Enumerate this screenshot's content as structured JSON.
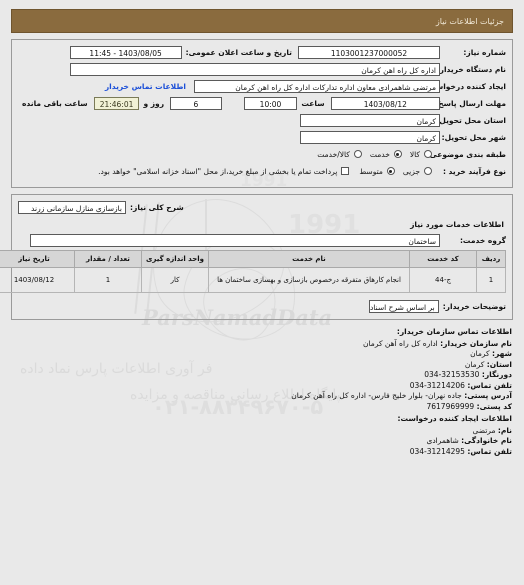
{
  "header": {
    "title": "جزئیات اطلاعات نیاز"
  },
  "form": {
    "need_number_label": "شماره نیاز:",
    "need_number_value": "1103001237000052",
    "announce_datetime_label": "تاریخ و ساعت اعلان عمومی:",
    "announce_datetime_value": "1403/08/05 - 11:45",
    "buyer_org_label": "نام دستگاه خریدار:",
    "buyer_org_value": "اداره کل راه اهن کرمان",
    "requester_label": "ایجاد کننده درخواست:",
    "requester_value": "مرتضی  شاهمرادی  معاون اداره تدارکات  اداره کل راه اهن کرمان",
    "buyer_contact_link": "اطلاعات تماس خریدار",
    "deadline_label": "مهلت ارسال پاسخ: تا تاریخ:",
    "deadline_date": "1403/08/12",
    "deadline_hour_label": "ساعت",
    "deadline_hour": "10:00",
    "remaining_days": "6",
    "days_and_label": "روز و",
    "remaining_time": "21:46:01",
    "remaining_suffix": "ساعت باقی مانده",
    "province_label": "استان محل تحویل:",
    "province_value": "کرمان",
    "city_label": "شهر محل تحویل:",
    "city_value": "کرمان",
    "category_label": "طبقه بندی موضوعی:",
    "category_options": [
      {
        "label": "کالا",
        "selected": false
      },
      {
        "label": "خدمت",
        "selected": true
      },
      {
        "label": "کالا/خدمت",
        "selected": false
      }
    ],
    "process_label": "نوع فرآیند خرید :",
    "process_options": [
      {
        "label": "جزیی",
        "selected": false
      },
      {
        "label": "متوسط",
        "selected": true
      }
    ],
    "payment_checkbox_label": "پرداخت تمام یا بخشی از مبلغ خرید،از محل \"اسناد خزانه اسلامی\" خواهد بود.",
    "payment_checked": false
  },
  "need": {
    "summary_label": "شرح کلی نیاز:",
    "summary_value": "بازسازی منازل سازمانی زرند",
    "services_section_title": "اطلاعات خدمات مورد نیاز",
    "service_group_label": "گروه خدمت:",
    "service_group_value": "ساختمان"
  },
  "table": {
    "columns": [
      "ردیف",
      "کد خدمت",
      "نام خدمت",
      "واحد اندازه گیری",
      "تعداد / مقدار",
      "تاریخ نیاز"
    ],
    "rows": [
      {
        "row_no": "1",
        "service_code": "ج-44",
        "service_name": "انجام کارهاق متفرقه درخصوص بازسازی و بهسازی ساختمان ها",
        "unit": "کار",
        "quantity": "1",
        "need_date": "1403/08/12"
      }
    ]
  },
  "buyer_note": {
    "label": "توضیحات خریدار:",
    "value": "بر اساس شرح اسناد"
  },
  "buyer_contact": {
    "section_title": "اطلاعات تماس سازمان خریدار:",
    "org_name_label": "نام سازمان خریدار:",
    "org_name_value": "اداره کل راه آهن کرمان",
    "city_label": "شهر:",
    "city_value": "کرمان",
    "province_label": "استان:",
    "province_value": "کرمان",
    "fax_label": "دورنگار:",
    "fax_value": "32153530-034",
    "phone_label": "تلفن تماس:",
    "phone_value": "31214206-034",
    "address_label": "آدرس پستی:",
    "address_value": "جاده نهران- بلوار خلیج فارس- اداره کل راه آهن کرمان",
    "postal_label": "کد پستی:",
    "postal_value": "7617969999"
  },
  "requester_contact": {
    "section_title": "اطلاعات ایجاد کننده درخواست:",
    "first_name_label": "نام:",
    "first_name_value": "مرتضی",
    "last_name_label": "نام خانوادگی:",
    "last_name_value": "شاهمرادی",
    "phone_label": "تلفن تماس:",
    "phone_value": "31214295-034"
  },
  "watermark": {
    "brand_en": "ParsNamadData",
    "line1": "پایگاه اطلاع رسانی مناقصه و مزایده",
    "line2": "فر آوری اطلاعات پارس نماد داده",
    "phone": "۰۲۱-۸۸۳۴۹۶۷۰-۵",
    "digits1": "1991",
    "digits2": "1991"
  },
  "colors": {
    "header_bg": "#8a6b3e",
    "link": "#1b4fd8",
    "countdown_bg": "#f1f1d6",
    "page_bg": "#e9e9e9"
  }
}
